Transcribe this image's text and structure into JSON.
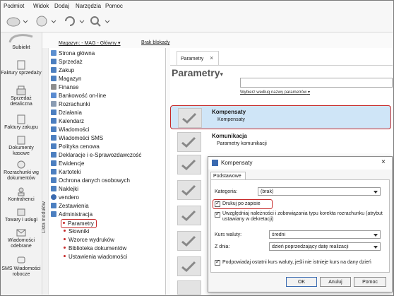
{
  "menu": [
    "Podmiot",
    "Widok",
    "Dodaj",
    "Narzędzia",
    "Pomoc"
  ],
  "toolbar": {
    "warehouse_label": "Magazyn: - MAG - Główny",
    "lock_label": "Brak blokady"
  },
  "logo": "Subiekt",
  "sidebar": {
    "items": [
      {
        "label": "Faktury sprzedaży",
        "icon": "invoice-icon"
      },
      {
        "label": "Sprzedaż detaliczna",
        "icon": "cash-register-icon"
      },
      {
        "label": "Faktury zakupu",
        "icon": "purchase-icon"
      },
      {
        "label": "Dokumenty kasowe",
        "icon": "cash-docs-icon"
      },
      {
        "label": "Rozrachunki wg dokumentów",
        "icon": "settlements-icon"
      },
      {
        "label": "Kontrahenci",
        "icon": "contractors-icon"
      },
      {
        "label": "Towary i usługi",
        "icon": "goods-icon"
      },
      {
        "label": "Wiadomości odebrane",
        "icon": "inbox-icon"
      },
      {
        "label": "SMS Wiadomości robocze",
        "icon": "sms-icon"
      }
    ],
    "vertical_label": "Lista modułów"
  },
  "tree": {
    "items": [
      "Strona główna",
      "Sprzedaż",
      "Zakup",
      "Magazyn",
      "Finanse",
      "Bankowość on-line",
      "Rozrachunki",
      "Działania",
      "Kalendarz",
      "Wiadomości",
      "Wiadomości SMS",
      "Polityka cenowa",
      "Deklaracje i e-Sprawozdawczość",
      "Ewidencje",
      "Kartoteki",
      "Ochrona danych osobowych",
      "Naklejki",
      "vendero",
      "Zestawienia",
      "Administracja"
    ],
    "subitems": [
      "Parametry",
      "Słowniki",
      "Wzorce wydruków",
      "Biblioteka dokumentów",
      "Ustawienia wiadomości"
    ]
  },
  "main": {
    "tab_label": "Parametry",
    "tab_close": "×",
    "heading": "Parametry",
    "search_hint": "Wybierz według nazwy parametrów",
    "cards": [
      {
        "title": "Kompensaty",
        "subtitle": "Kompensaty"
      },
      {
        "title": "Komunikacja",
        "subtitle": "Parametry komunikacji"
      }
    ]
  },
  "dialog": {
    "title": "Kompensaty",
    "tab": "Podstawowe",
    "category_label": "Kategoria:",
    "category_value": "(brak)",
    "print_on_save": "Drukuj po zapisie",
    "include_label": "Uwzględniaj należności i zobowiązania typu korekta rozrachunku (atrybut ustawiany w dekretacji)",
    "rate_label": "Kurs waluty:",
    "rate_value": "średni",
    "from_day_label": "Z dnia:",
    "from_day_value": "dzień poprzedzający datę realizacji",
    "suggest_label": "Podpowiadaj ostatni kurs waluty, jeśli nie istnieje kurs na dany dzień",
    "ok": "OK",
    "cancel": "Anuluj",
    "help": "Pomoc",
    "close": "×"
  },
  "colors": {
    "highlight": "#c62828",
    "selection": "#cfe5f7"
  }
}
